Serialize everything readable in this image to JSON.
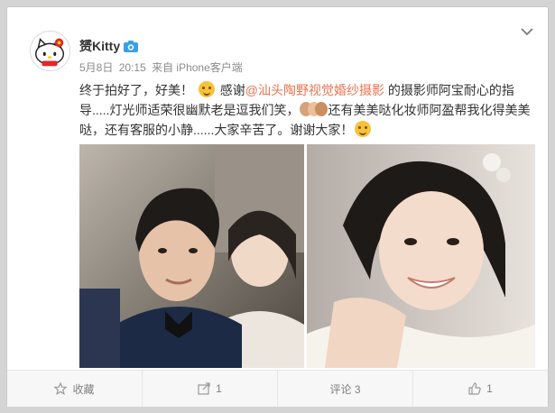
{
  "post": {
    "user": {
      "name": "赟Kitty",
      "avatar_icon": "hello-kitty-avatar",
      "badge_icon": "camera-vip-icon"
    },
    "meta": {
      "date": "5月8日",
      "time": "20:15",
      "source": "来自 iPhone客户端"
    },
    "content": {
      "part1": "终于拍好了，好美！",
      "part2": "感谢",
      "mention": "@汕头陶野视觉婚纱摄影",
      "part3": "的摄影师阿宝耐心的指导.....灯光师适荣很幽默老是逗我们笑，",
      "part4": "还有美美哒化妆师阿盈帮我化得美美哒，还有客服的小静......大家辛苦了。谢谢大家！",
      "emoji_1": "smirk-emoji",
      "emoji_2": "group-emoji",
      "emoji_3": "kiss-emoji"
    },
    "photos": [
      {
        "id": "photo-couple",
        "desc_icon": "couple-photo"
      },
      {
        "id": "photo-bride",
        "desc_icon": "bride-photo"
      }
    ],
    "actions": {
      "favorite": {
        "label": "收藏",
        "icon": "star-icon"
      },
      "repost": {
        "label": "1",
        "icon": "repost-icon"
      },
      "comment": {
        "label": "评论 3",
        "icon": "comment-icon"
      },
      "like": {
        "label": "1",
        "icon": "thumbs-up-icon"
      }
    },
    "more_icon": "chevron-down-icon"
  },
  "colors": {
    "mention": "#eb7350",
    "text": "#333333",
    "meta": "#8c8c8c",
    "badge": "#39a0e6"
  }
}
